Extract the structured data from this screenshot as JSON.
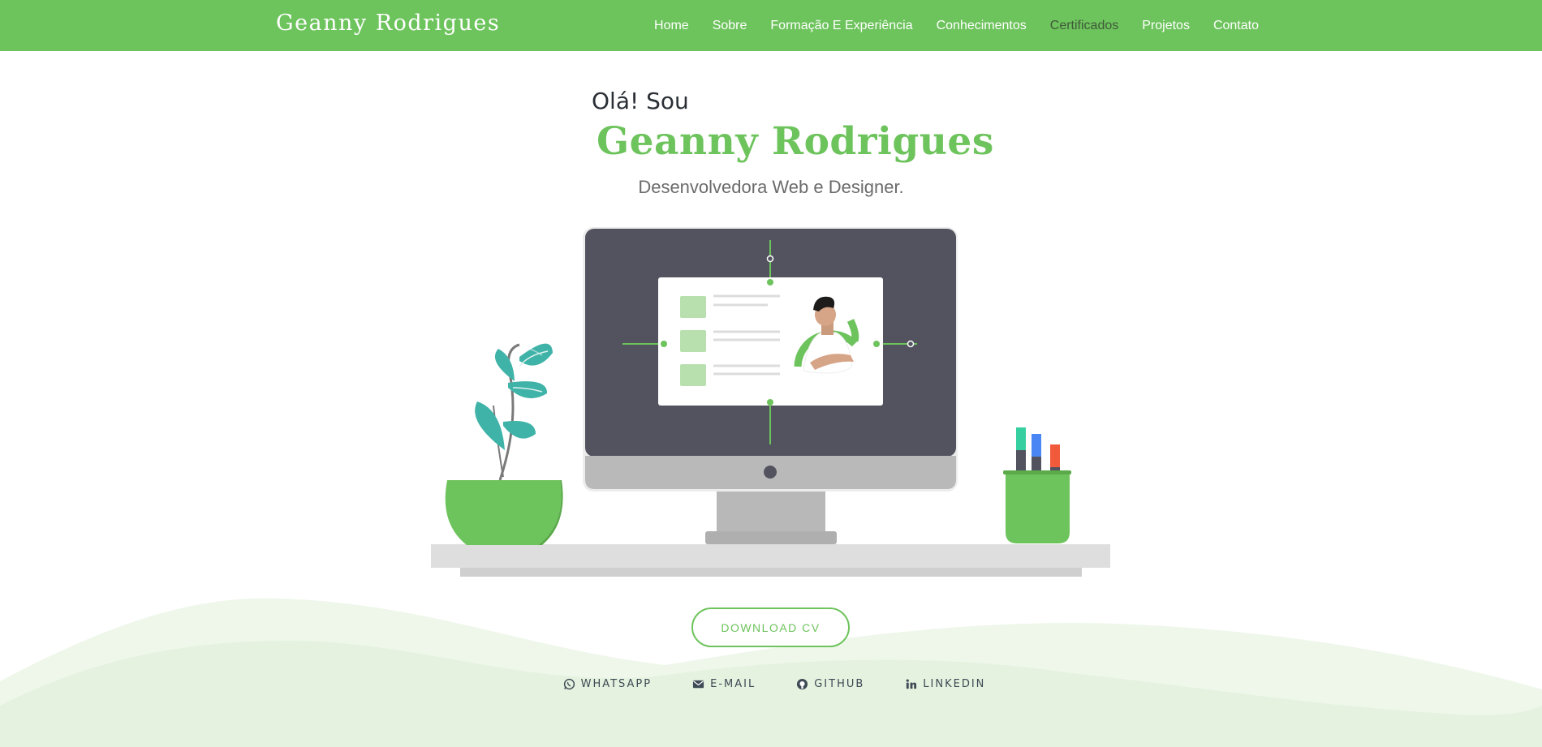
{
  "brand": "Geanny Rodrigues",
  "nav": {
    "items": [
      {
        "label": "Home"
      },
      {
        "label": "Sobre"
      },
      {
        "label": "Formação E Experiência"
      },
      {
        "label": "Conhecimentos"
      },
      {
        "label": "Certificados"
      },
      {
        "label": "Projetos"
      },
      {
        "label": "Contato"
      }
    ],
    "active_index": 4
  },
  "hero": {
    "greeting": "Olá! Sou",
    "name": "Geanny Rodrigues",
    "subtitle": "Desenvolvedora Web e Designer."
  },
  "cta": {
    "download_label": "DOWNLOAD CV"
  },
  "socials": [
    {
      "label": "WHATSAPP",
      "icon": "whatsapp-icon"
    },
    {
      "label": "E-MAIL",
      "icon": "envelope-icon"
    },
    {
      "label": "GITHUB",
      "icon": "github-icon"
    },
    {
      "label": "LINKEDIN",
      "icon": "linkedin-icon"
    }
  ],
  "colors": {
    "accent": "#6dc35c",
    "nav_active": "#3f5a3a",
    "monitor_screen": "#52535f",
    "monitor_stand": "#b9b9b9",
    "leaf": "#3fb3a8",
    "wave_light": "#e8f4e3"
  }
}
